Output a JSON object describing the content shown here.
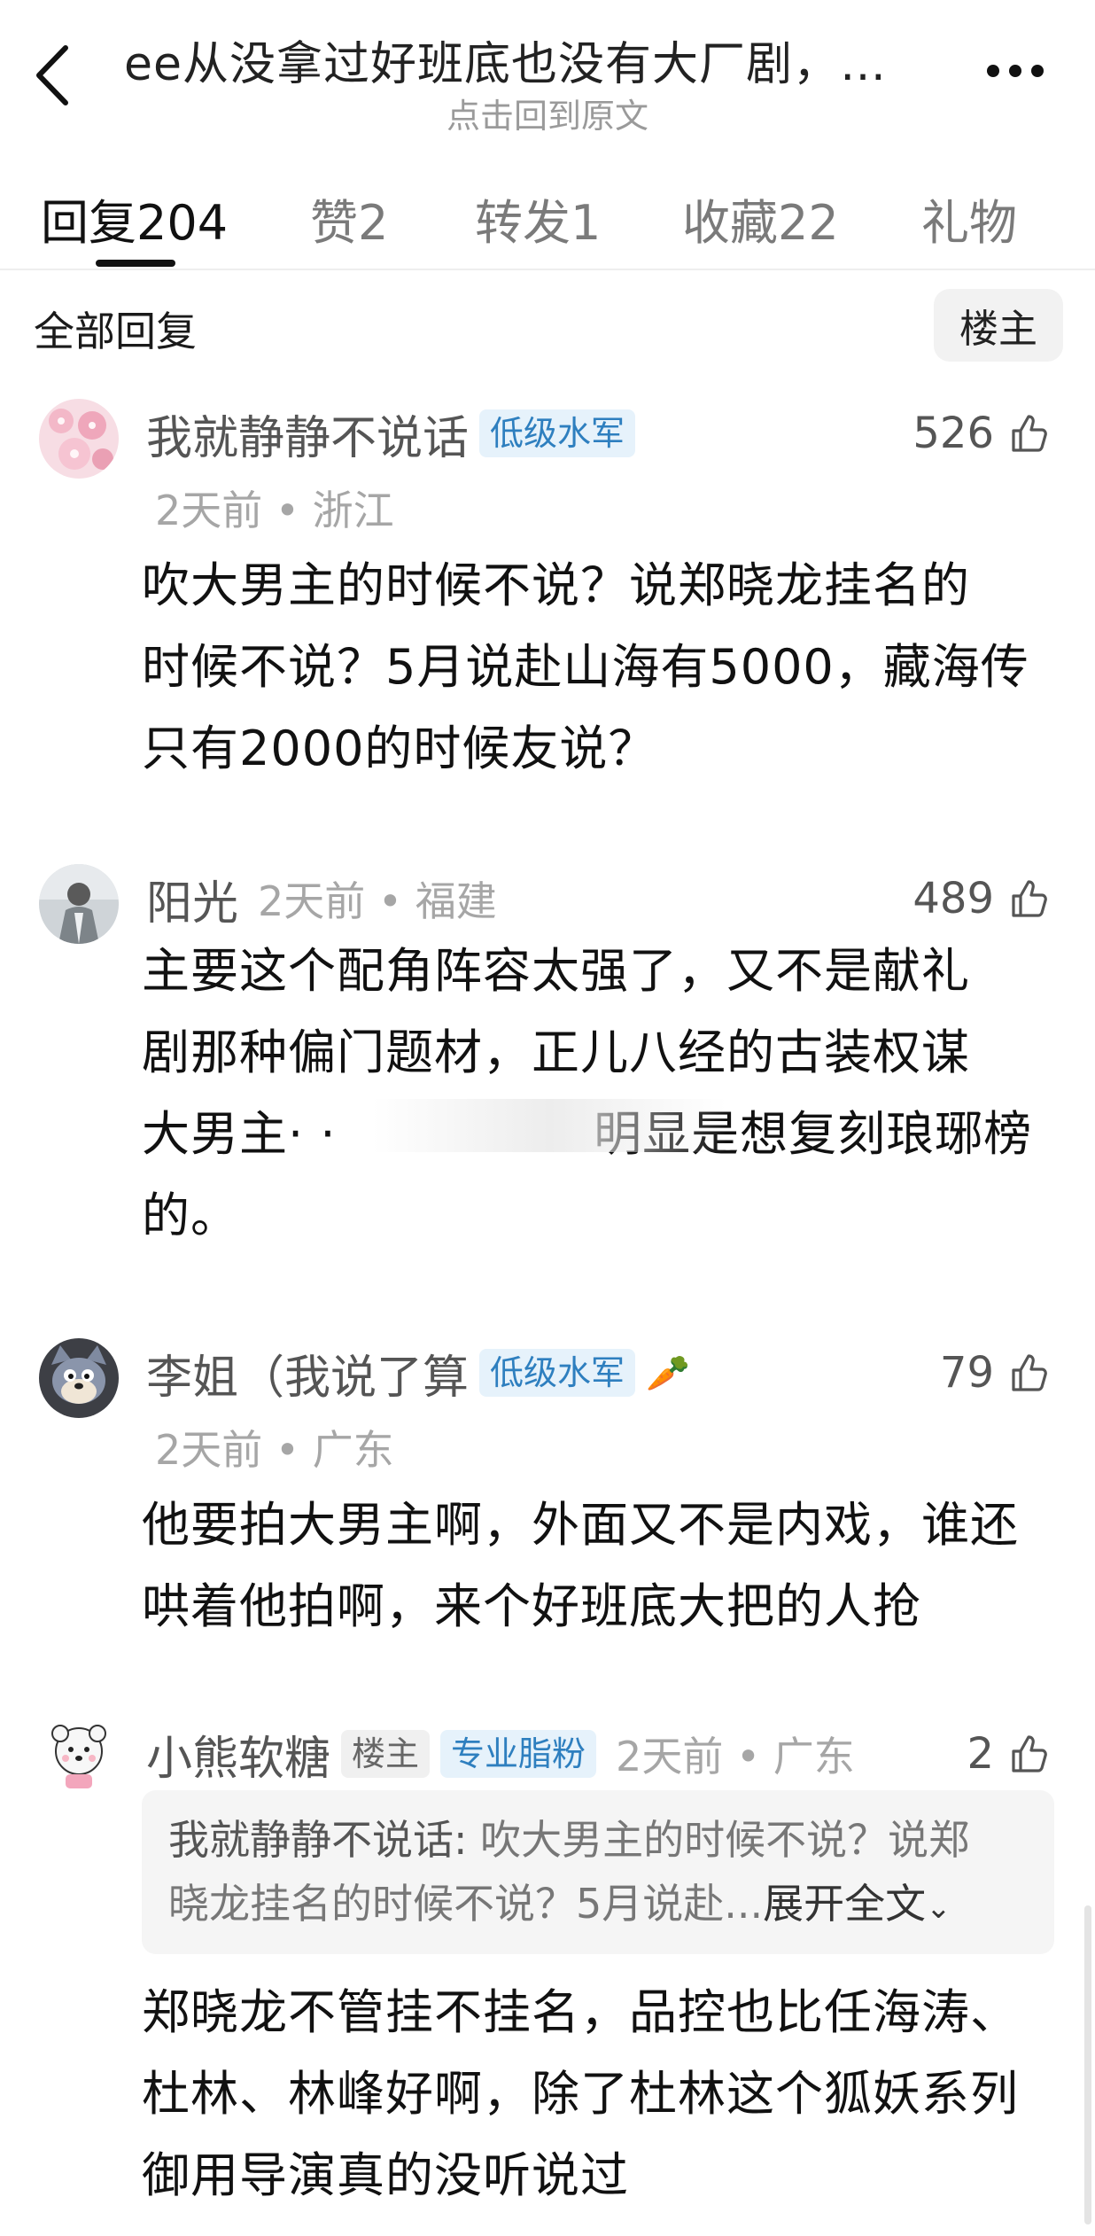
{
  "header": {
    "title": "ee从没拿过好班底也没有大厂剧，不……",
    "subtitle": "点击回到原文"
  },
  "tabs": [
    {
      "label": "回复",
      "count": "204"
    },
    {
      "label": "赞",
      "count": "2"
    },
    {
      "label": "转发",
      "count": "1"
    },
    {
      "label": "收藏",
      "count": "22"
    },
    {
      "label": "礼物",
      "count": ""
    }
  ],
  "filter": {
    "all_label": "全部回复",
    "op_label": "楼主"
  },
  "comments": [
    {
      "username": "我就静静不说话",
      "badges": [
        "低级水军"
      ],
      "time": "2天前",
      "location": "浙江",
      "likes": "526",
      "lines": [
        "吹大男主的时候不说？说郑晓龙挂名的",
        "时候不说？5月说赴山海有5000，藏海传",
        "只有2000的时候友说？"
      ]
    },
    {
      "username": "阳光",
      "badges": [],
      "time": "2天前",
      "location": "福建",
      "likes": "489",
      "lines": [
        "主要这个配角阵容太强了，又不是献礼",
        "剧那种偏门题材，正儿八经的古装权谋",
        "大男主· ·                明显是想复刻琅琊榜",
        "的。"
      ]
    },
    {
      "username": "李姐（我说了算",
      "badges": [
        "低级水军"
      ],
      "emoji": "🥕",
      "time": "2天前",
      "location": "广东",
      "likes": "79",
      "lines": [
        "他要拍大男主啊，外面又不是内戏，谁还",
        "哄着他拍啊，来个好班底大把的人抢"
      ]
    },
    {
      "username": "小熊软糖",
      "badges": [
        "楼主",
        "专业脂粉"
      ],
      "time": "2天前",
      "location": "广东",
      "likes": "2",
      "quote": {
        "author": "我就静静不说话:",
        "line1": "吹大男主的时候不说？说郑",
        "line2": "晓龙挂名的时候不说？5月说赴...",
        "expand": "展开全文"
      },
      "lines": [
        "郑晓龙不管挂不挂名，品控也比任海涛、",
        "杜林、林峰好啊，除了杜林这个狐妖系列",
        "御用导演真的没听说过"
      ]
    }
  ],
  "colors": {
    "badge_blue": "#2e7fbf",
    "badge_blue_bg": "#e6f2fb",
    "muted": "#a6a6a6"
  }
}
